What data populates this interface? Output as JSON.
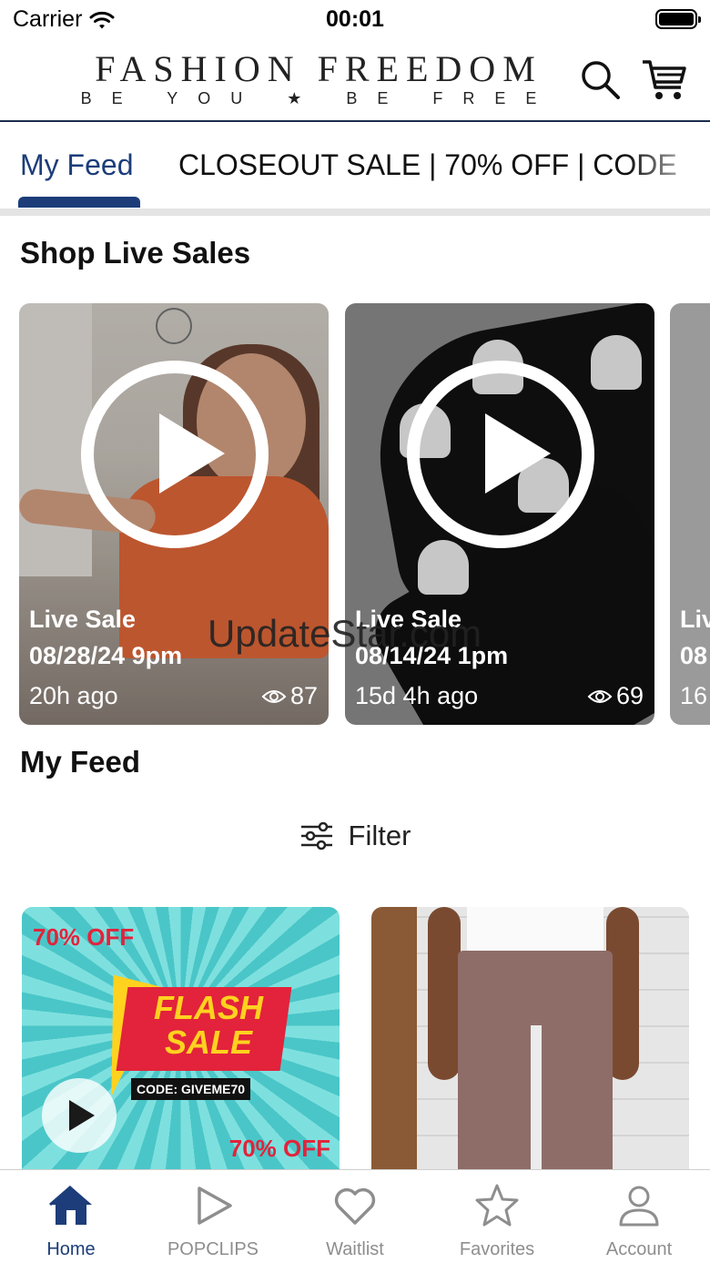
{
  "status_bar": {
    "carrier": "Carrier",
    "time": "00:01"
  },
  "header": {
    "logo_title": "FASHION FREEDOM",
    "logo_tagline": "BE YOU ★ BE FREE",
    "search_icon": "search-icon",
    "cart_icon": "cart-icon"
  },
  "tabs": [
    {
      "label": "My Feed",
      "active": true
    },
    {
      "label": "CLOSEOUT SALE | 70% OFF | CODE",
      "active": false
    }
  ],
  "live_sales": {
    "title": "Shop Live Sales",
    "cards": [
      {
        "label": "Live Sale",
        "date": "08/28/24 9pm",
        "ago": "20h ago",
        "views": "87"
      },
      {
        "label": "Live Sale",
        "date": "08/14/24 1pm",
        "ago": "15d 4h ago",
        "views": "69"
      },
      {
        "label": "Liv",
        "date": "08",
        "ago": "16",
        "views": ""
      }
    ]
  },
  "watermark": "UpdateStar.com",
  "feed": {
    "title": "My Feed",
    "filter_label": "Filter",
    "cards": [
      {
        "off_top": "70% OFF",
        "flash_text": "FLASH SALE",
        "code": "CODE: GIVEME70",
        "off_bottom": "70% OFF"
      },
      {
        "image": "brown-pants"
      }
    ]
  },
  "bottom_nav": [
    {
      "label": "Home",
      "icon": "home-icon",
      "active": true
    },
    {
      "label": "POPCLIPS",
      "icon": "play-icon",
      "active": false
    },
    {
      "label": "Waitlist",
      "icon": "heart-icon",
      "active": false
    },
    {
      "label": "Favorites",
      "icon": "star-icon",
      "active": false
    },
    {
      "label": "Account",
      "icon": "person-icon",
      "active": false
    }
  ],
  "colors": {
    "brand_navy": "#1c3d7a",
    "nav_inactive": "#8e8e8e",
    "sale_red": "#e2233b"
  }
}
